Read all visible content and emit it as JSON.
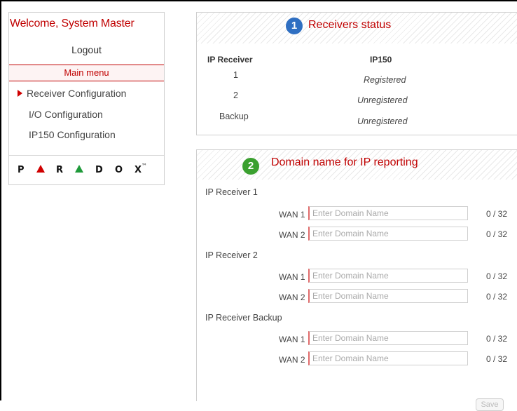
{
  "sidebar": {
    "welcome": "Welcome, System Master",
    "logout": "Logout",
    "menu_header": "Main menu",
    "items": [
      {
        "label": "Receiver Configuration",
        "active": true
      },
      {
        "label": "I/O Configuration",
        "active": false
      },
      {
        "label": "IP150 Configuration",
        "active": false
      }
    ],
    "logo_letters": [
      "P",
      "R",
      "D",
      "O",
      "X"
    ],
    "logo_tm": "™"
  },
  "status_panel": {
    "step": "1",
    "title": "Receivers status",
    "col1_header": "IP Receiver",
    "col2_header": "IP150",
    "rows": [
      {
        "receiver": "1",
        "status": "Registered"
      },
      {
        "receiver": "2",
        "status": "Unregistered"
      },
      {
        "receiver": "Backup",
        "status": "Unregistered"
      }
    ]
  },
  "domain_panel": {
    "step": "2",
    "title": "Domain name for IP reporting",
    "placeholder": "Enter Domain Name",
    "groups": [
      {
        "label": "IP Receiver 1",
        "wans": [
          {
            "label": "WAN 1",
            "value": "",
            "count": "0 / 32"
          },
          {
            "label": "WAN 2",
            "value": "",
            "count": "0 / 32"
          }
        ]
      },
      {
        "label": "IP Receiver 2",
        "wans": [
          {
            "label": "WAN 1",
            "value": "",
            "count": "0 / 32"
          },
          {
            "label": "WAN 2",
            "value": "",
            "count": "0 / 32"
          }
        ]
      },
      {
        "label": "IP Receiver Backup",
        "wans": [
          {
            "label": "WAN 1",
            "value": "",
            "count": "0 / 32"
          },
          {
            "label": "WAN 2",
            "value": "",
            "count": "0 / 32"
          }
        ]
      }
    ],
    "save_label": "Save",
    "save_enabled": false
  },
  "colors": {
    "accent_red": "#c00000",
    "badge_blue": "#2f6fc2",
    "badge_green": "#3aa02f",
    "logo_red": "#d00000",
    "logo_green": "#1f9a3a"
  },
  "icons": {
    "active_menu_marker": "caret-right-icon",
    "logo_triangles": [
      "triangle-red-icon",
      "triangle-green-icon"
    ]
  }
}
